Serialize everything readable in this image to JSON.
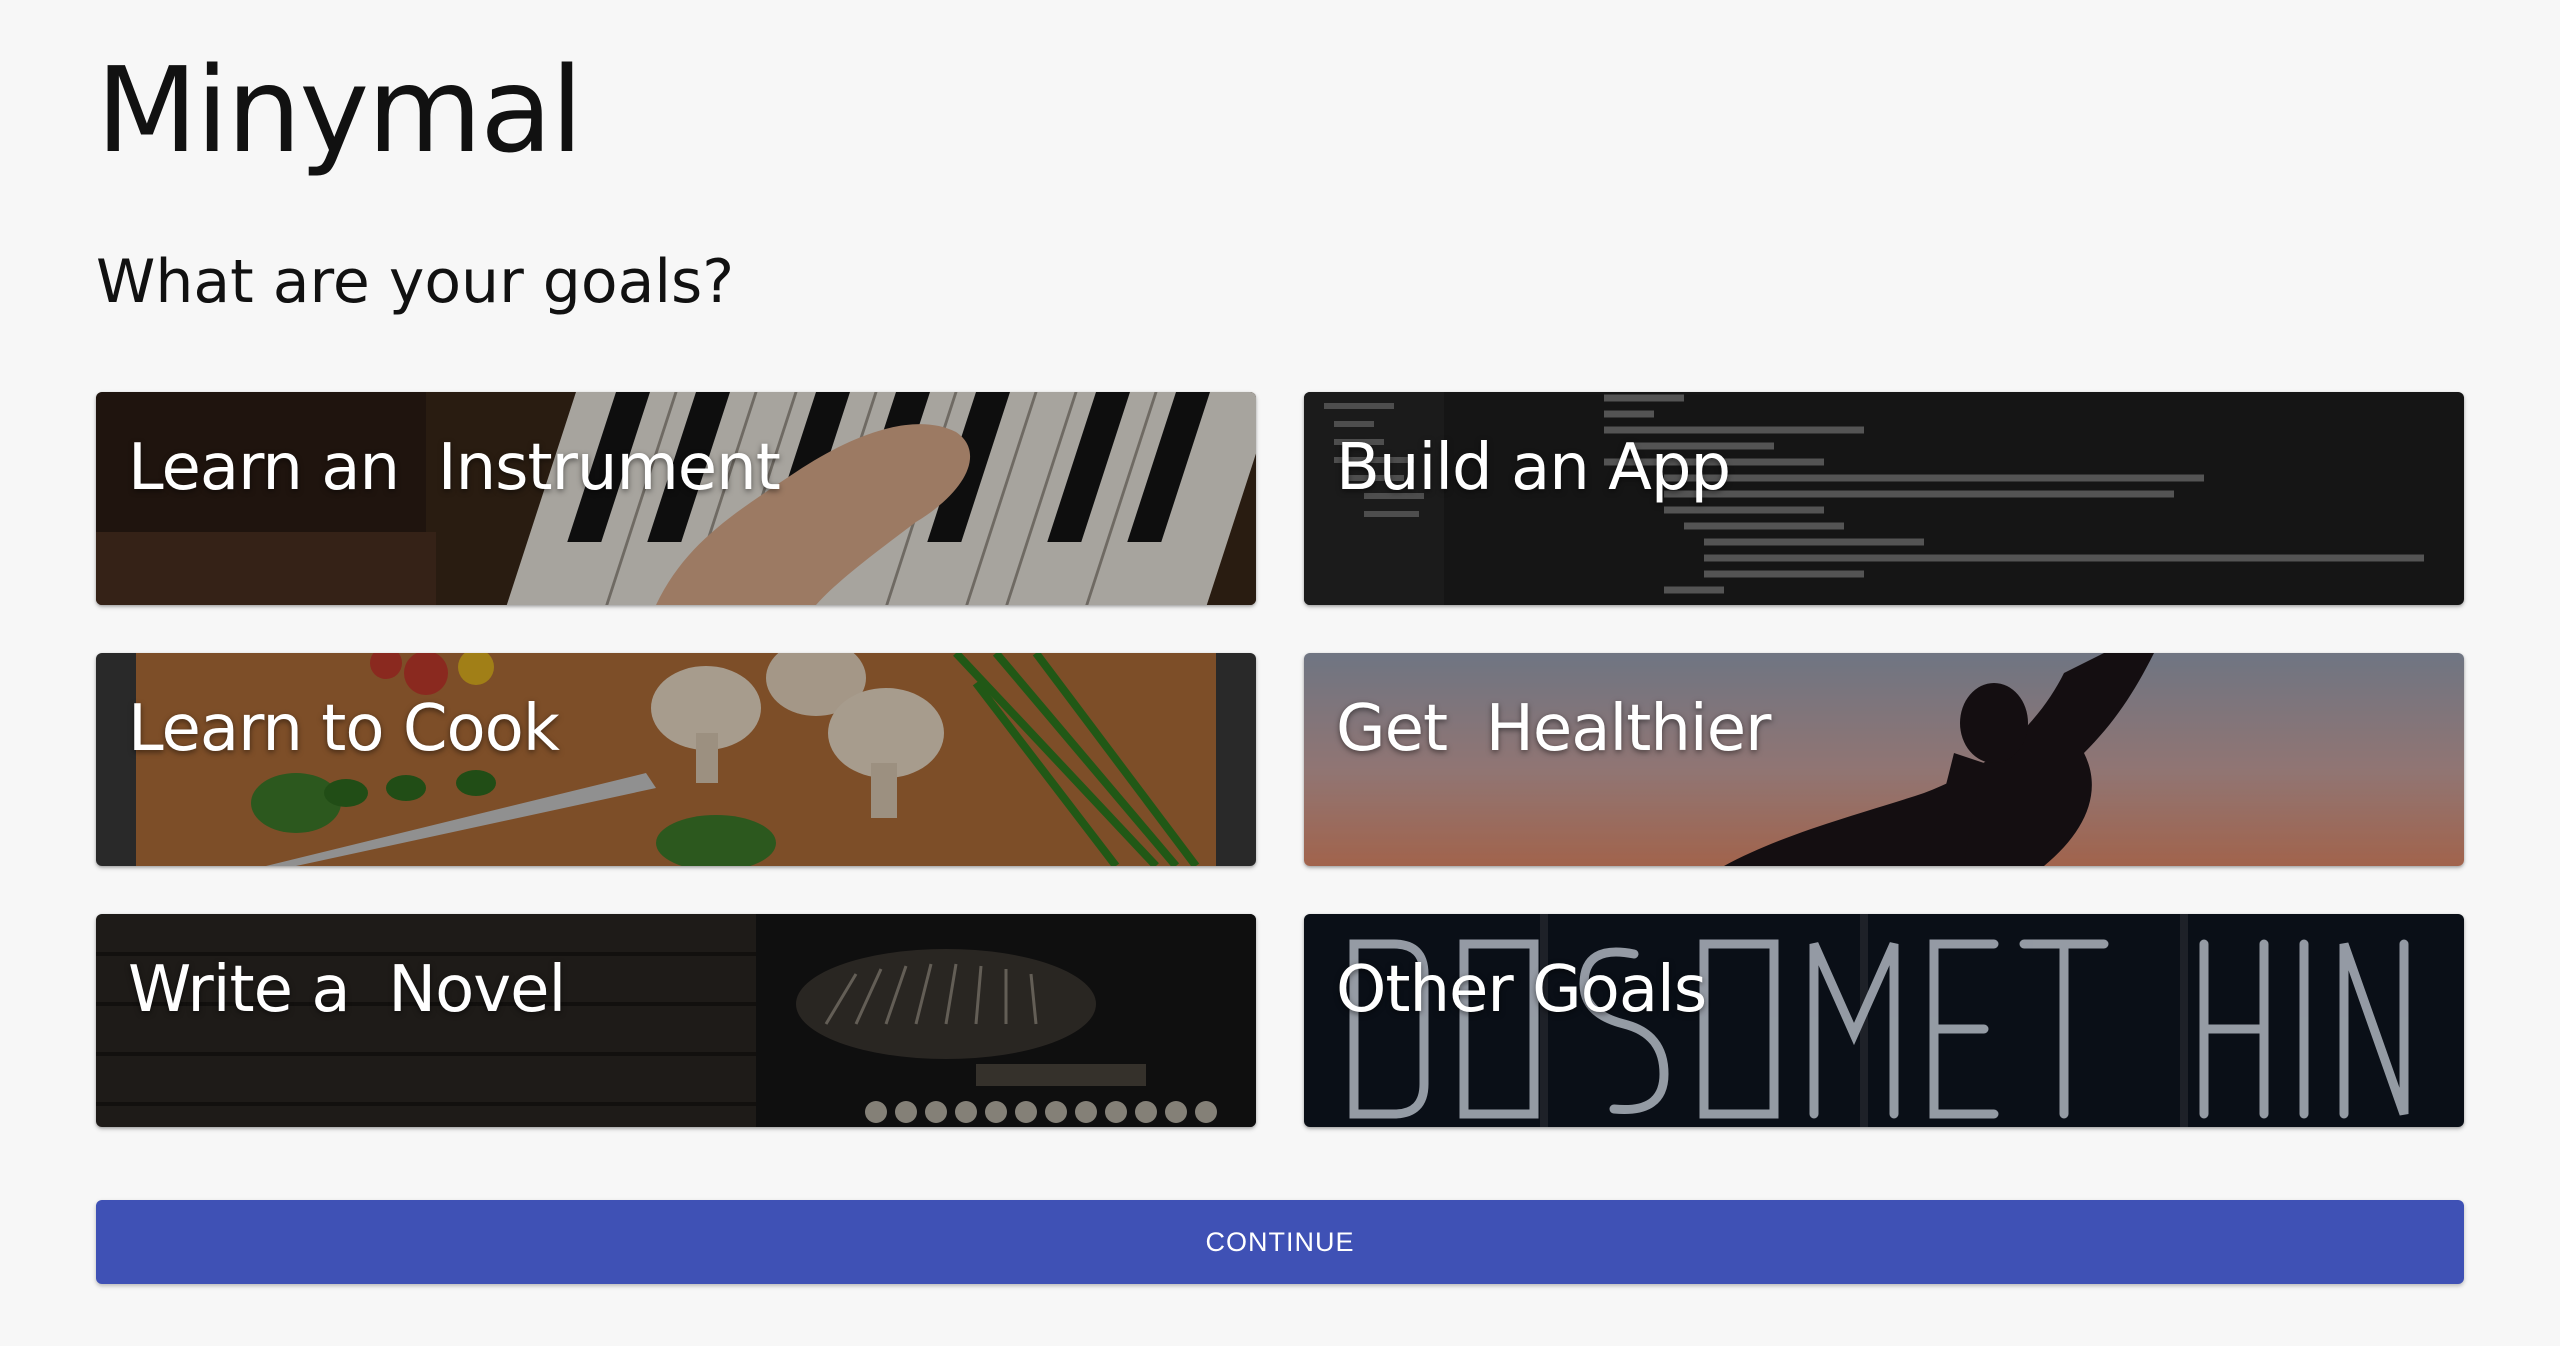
{
  "app": {
    "title": "Minymal"
  },
  "main": {
    "question": "What are your goals?",
    "goals": [
      {
        "label": "Learn an  Instrument",
        "image": "piano-keys"
      },
      {
        "label": "Build an App",
        "image": "code-editor"
      },
      {
        "label": "Learn to Cook",
        "image": "cutting-board-vegetables"
      },
      {
        "label": "Get  Healthier",
        "image": "yoga-silhouette-sunset"
      },
      {
        "label": "Write a  Novel",
        "image": "typewriter"
      },
      {
        "label": "Other Goals",
        "image": "neon-sign"
      }
    ],
    "continue_label": "CONTINUE"
  },
  "colors": {
    "background": "#f7f7f7",
    "accent": "#3f51b5",
    "card_text": "#ffffff"
  }
}
